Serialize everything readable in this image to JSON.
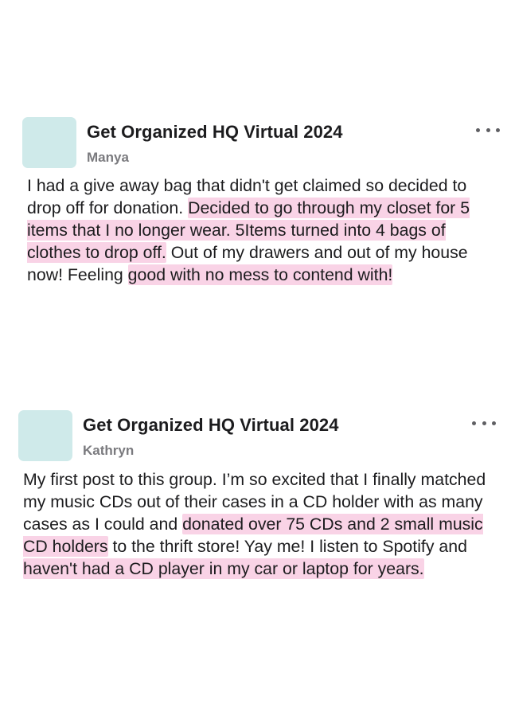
{
  "colors": {
    "avatar_bg": "#cfeaea",
    "highlight": "#f9d3e6"
  },
  "posts": [
    {
      "group_name": "Get Organized HQ Virtual 2024",
      "author": "Manya",
      "more_icon": "more-horizontal-icon",
      "body": [
        {
          "text": "I had a give away bag that didn't get claimed so decided to drop off for donation. ",
          "highlight": false
        },
        {
          "text": "Decided to go through my closet for 5 items that I no longer wear. 5Items turned into 4 bags of clothes to drop off.",
          "highlight": true
        },
        {
          "text": " Out of my drawers and out of my house now! Feeling ",
          "highlight": false
        },
        {
          "text": "good with no mess to contend with!",
          "highlight": true
        }
      ]
    },
    {
      "group_name": "Get Organized HQ Virtual 2024",
      "author": "Kathryn",
      "more_icon": "more-horizontal-icon",
      "body": [
        {
          "text": "My first post to this group. I’m so excited that I finally matched my music CDs out of their cases in a CD holder with as many cases as I could and ",
          "highlight": false
        },
        {
          "text": "donated over 75 CDs and 2 small music CD holders",
          "highlight": true
        },
        {
          "text": " to the thrift store! Yay me! I listen to Spotify and ",
          "highlight": false
        },
        {
          "text": "haven't had a CD player in my car or laptop for years.",
          "highlight": true
        }
      ]
    }
  ]
}
